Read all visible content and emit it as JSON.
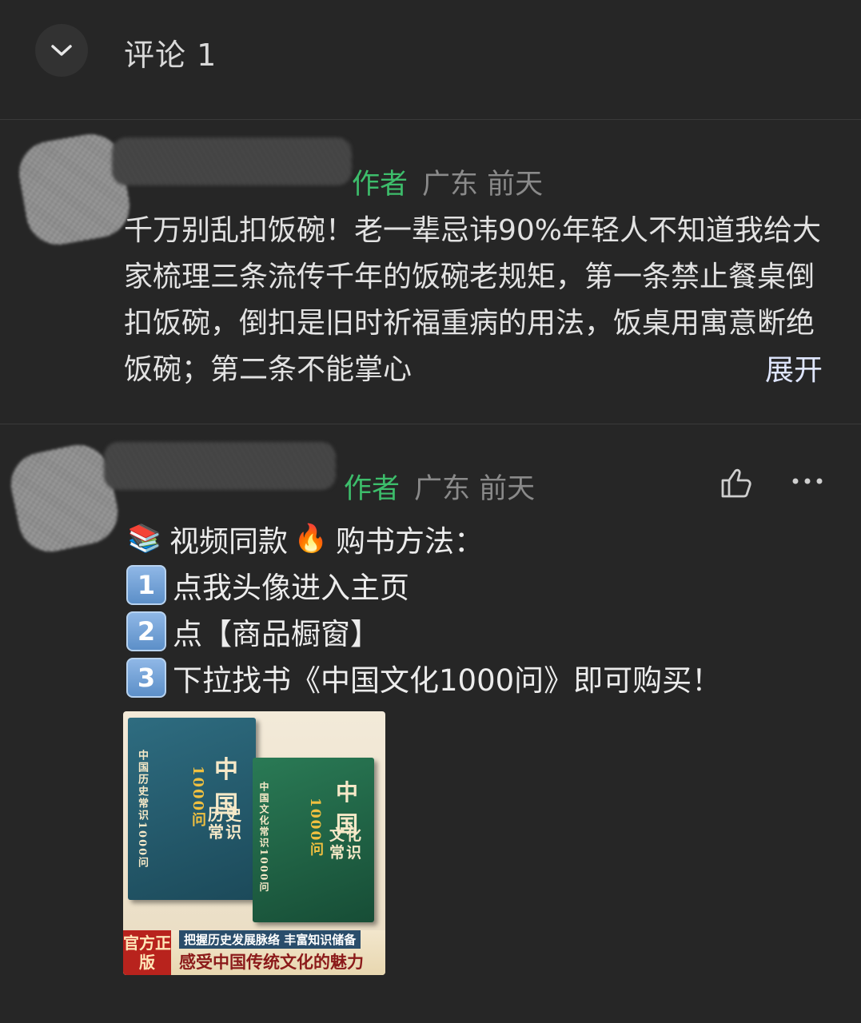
{
  "header": {
    "title": "评论 1",
    "collapse_icon": "chevron-down-icon"
  },
  "comments": [
    {
      "author_tag": "作者",
      "location": "广东",
      "time": "前天",
      "text": "千万别乱扣饭碗！老一辈忌讳90%年轻人不知道我给大家梳理三条流传千年的饭碗老规矩，第一条禁止餐桌倒扣饭碗，倒扣是旧时祈福重病的用法，饭桌用寓意断绝饭碗；第二条不能掌心",
      "expand_label": "展开"
    },
    {
      "author_tag": "作者",
      "location": "广东",
      "time": "前天",
      "like_icon": "thumbs-up-icon",
      "more_icon": "more-icon",
      "lines": [
        {
          "icon": "books-emoji",
          "glyph": "📚",
          "text": "视频同款"
        },
        {
          "icon": "1-keycap",
          "glyph": "1",
          "text": "点我头像进入主页"
        },
        {
          "icon": "2-keycap",
          "glyph": "2",
          "text": "点【商品橱窗】"
        },
        {
          "icon": "3-keycap",
          "glyph": "3",
          "text": "下拉找书《中国文化1000问》即可购买！"
        }
      ],
      "line1_suffix_glyph": "🔥",
      "line1_suffix_text": "购书方法：",
      "ad": {
        "book1_title": "中国历史常识1000问",
        "book1_big": "中国",
        "book1_sub": "历史常识",
        "book2_title": "中国文化常识1000问",
        "book2_big": "中国",
        "book2_sub": "文化常识",
        "book_num": "1000问",
        "badge": "官方正版",
        "line1": "把握历史发展脉络 丰富知识储备",
        "line2": "感受中国传统文化的魅力"
      }
    }
  ]
}
